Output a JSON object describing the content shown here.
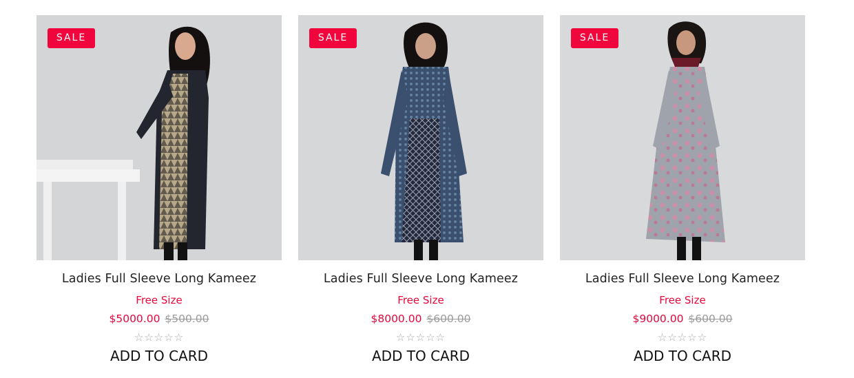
{
  "products": [
    {
      "badge": "SALE",
      "title": "Ladies Full Sleeve Long Kameez",
      "size": "Free Size",
      "price": "$5000.00",
      "old_price": "$500.00",
      "rating_stars": "☆☆☆☆☆",
      "action": "ADD TO CARD",
      "image_desc": "woman in black kameez with beige patterned panel"
    },
    {
      "badge": "SALE",
      "title": "Ladies Full Sleeve Long Kameez",
      "size": "Free Size",
      "price": "$8000.00",
      "old_price": "$600.00",
      "rating_stars": "☆☆☆☆☆",
      "action": "ADD TO CARD",
      "image_desc": "woman in navy and blue printed kameez"
    },
    {
      "badge": "SALE",
      "title": "Ladies Full Sleeve Long Kameez",
      "size": "Free Size",
      "price": "$9000.00",
      "old_price": "$600.00",
      "rating_stars": "☆☆☆☆☆",
      "action": "ADD TO CARD",
      "image_desc": "woman in grey kameez with pink floral print"
    }
  ],
  "colors": {
    "accent": "#f0063c",
    "photo_bg": "#d6d7d9"
  }
}
